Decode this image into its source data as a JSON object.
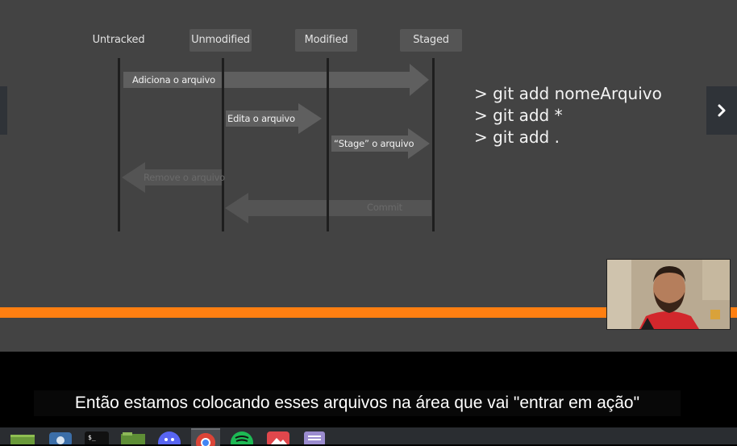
{
  "slide": {
    "states": [
      "Untracked",
      "Unmodified",
      "Modified",
      "Staged"
    ],
    "arrows": [
      {
        "label": "Adiciona o arquivo",
        "direction": "right"
      },
      {
        "label": "Edita o arquivo",
        "direction": "right"
      },
      {
        "label": "“Stage” o arquivo",
        "direction": "right"
      },
      {
        "label": "Remove o arquivo",
        "direction": "left"
      },
      {
        "label": "Commit",
        "direction": "left"
      }
    ],
    "commands": [
      "> git add nomeArquivo",
      "> git add *",
      "> git add ."
    ]
  },
  "subtitle": "Então estamos colocando esses arquivos na área que vai \"entrar em ação\"",
  "taskbar": {
    "apps": [
      "files-icon",
      "screenshot-icon",
      "terminal-icon",
      "folder-icon",
      "discord-icon",
      "chrome-icon",
      "spotify-icon",
      "image-viewer-icon",
      "text-editor-icon"
    ],
    "active_app": "chrome-icon",
    "terminal_glyph": "$_"
  },
  "colors": {
    "accent": "#ff7f11",
    "slide_bg": "#434343",
    "arrow": "#5f5f5f"
  }
}
